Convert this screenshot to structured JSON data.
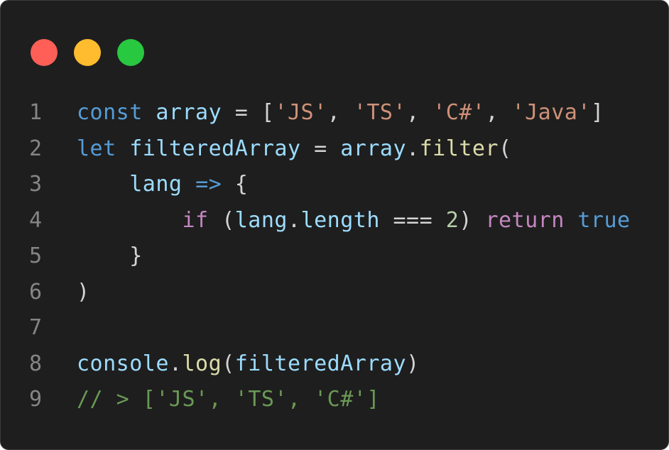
{
  "window": {
    "traffic_lights": [
      {
        "name": "close",
        "color": "#ff5f57"
      },
      {
        "name": "minimize",
        "color": "#febc2e"
      },
      {
        "name": "zoom",
        "color": "#28c840"
      }
    ]
  },
  "code": {
    "language": "javascript",
    "lines": [
      {
        "number": "1",
        "tokens": [
          {
            "t": "const",
            "c": "kw"
          },
          {
            "t": " ",
            "c": "plain"
          },
          {
            "t": "array",
            "c": "var"
          },
          {
            "t": " = [",
            "c": "plain"
          },
          {
            "t": "'JS'",
            "c": "str"
          },
          {
            "t": ", ",
            "c": "plain"
          },
          {
            "t": "'TS'",
            "c": "str"
          },
          {
            "t": ", ",
            "c": "plain"
          },
          {
            "t": "'C#'",
            "c": "str"
          },
          {
            "t": ", ",
            "c": "plain"
          },
          {
            "t": "'Java'",
            "c": "str"
          },
          {
            "t": "]",
            "c": "plain"
          }
        ]
      },
      {
        "number": "2",
        "tokens": [
          {
            "t": "let",
            "c": "kw"
          },
          {
            "t": " ",
            "c": "plain"
          },
          {
            "t": "filteredArray",
            "c": "var"
          },
          {
            "t": " = ",
            "c": "plain"
          },
          {
            "t": "array",
            "c": "var"
          },
          {
            "t": ".",
            "c": "plain"
          },
          {
            "t": "filter",
            "c": "fn"
          },
          {
            "t": "(",
            "c": "plain"
          }
        ]
      },
      {
        "number": "3",
        "tokens": [
          {
            "t": "    ",
            "c": "plain"
          },
          {
            "t": "lang",
            "c": "var"
          },
          {
            "t": " ",
            "c": "plain"
          },
          {
            "t": "=>",
            "c": "kw"
          },
          {
            "t": " {",
            "c": "plain"
          }
        ]
      },
      {
        "number": "4",
        "tokens": [
          {
            "t": "        ",
            "c": "plain"
          },
          {
            "t": "if",
            "c": "ctl"
          },
          {
            "t": " (",
            "c": "plain"
          },
          {
            "t": "lang",
            "c": "var"
          },
          {
            "t": ".",
            "c": "plain"
          },
          {
            "t": "length",
            "c": "var"
          },
          {
            "t": " === ",
            "c": "plain"
          },
          {
            "t": "2",
            "c": "num"
          },
          {
            "t": ") ",
            "c": "plain"
          },
          {
            "t": "return",
            "c": "ctl"
          },
          {
            "t": " ",
            "c": "plain"
          },
          {
            "t": "true",
            "c": "kw"
          }
        ]
      },
      {
        "number": "5",
        "tokens": [
          {
            "t": "    }",
            "c": "plain"
          }
        ]
      },
      {
        "number": "6",
        "tokens": [
          {
            "t": ")",
            "c": "plain"
          }
        ]
      },
      {
        "number": "7",
        "tokens": []
      },
      {
        "number": "8",
        "tokens": [
          {
            "t": "console",
            "c": "var"
          },
          {
            "t": ".",
            "c": "plain"
          },
          {
            "t": "log",
            "c": "fn"
          },
          {
            "t": "(",
            "c": "plain"
          },
          {
            "t": "filteredArray",
            "c": "var"
          },
          {
            "t": ")",
            "c": "plain"
          }
        ]
      },
      {
        "number": "9",
        "tokens": [
          {
            "t": "// > ['JS', 'TS', 'C#']",
            "c": "cmt"
          }
        ]
      }
    ]
  }
}
